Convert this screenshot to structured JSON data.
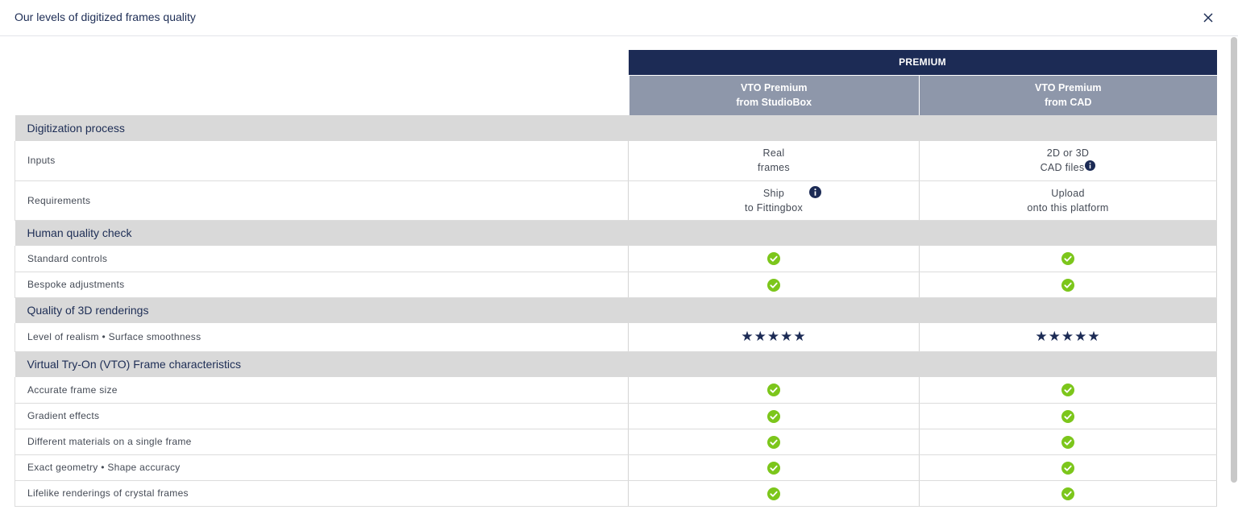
{
  "dialog": {
    "title": "Our levels of digitized frames quality",
    "close_icon": "close-icon"
  },
  "table": {
    "tier": "PREMIUM",
    "columns": [
      {
        "line1": "VTO Premium",
        "line2": "from StudioBox"
      },
      {
        "line1": "VTO Premium",
        "line2": "from CAD"
      }
    ],
    "sections": {
      "digitization": {
        "title": "Digitization process",
        "inputs": {
          "label": "Inputs",
          "a1": "Real",
          "a2": "frames",
          "b1": "2D or 3D",
          "b2": "CAD files"
        },
        "requirements": {
          "label": "Requirements",
          "a1": "Ship",
          "a2": "to Fittingbox",
          "b1": "Upload",
          "b2": "onto this platform"
        }
      },
      "quality_check": {
        "title": "Human quality check",
        "rows": [
          "Standard controls",
          "Bespoke adjustments"
        ]
      },
      "renderings": {
        "title": "Quality of 3D renderings",
        "row_label": "Level of realism • Surface smoothness",
        "rating_a": 5,
        "rating_b": 5,
        "stars_text": "★★★★★"
      },
      "vto": {
        "title": "Virtual Try-On (VTO) Frame characteristics",
        "rows": [
          "Accurate frame size",
          "Gradient effects",
          "Different materials on a single frame",
          "Exact geometry • Shape accuracy",
          "Lifelike renderings of crystal frames"
        ]
      }
    }
  },
  "colors": {
    "navy": "#1c2b55",
    "header_grey": "#8e97aa",
    "section_grey": "#d9d9d9",
    "check_green": "#7cc61b"
  }
}
